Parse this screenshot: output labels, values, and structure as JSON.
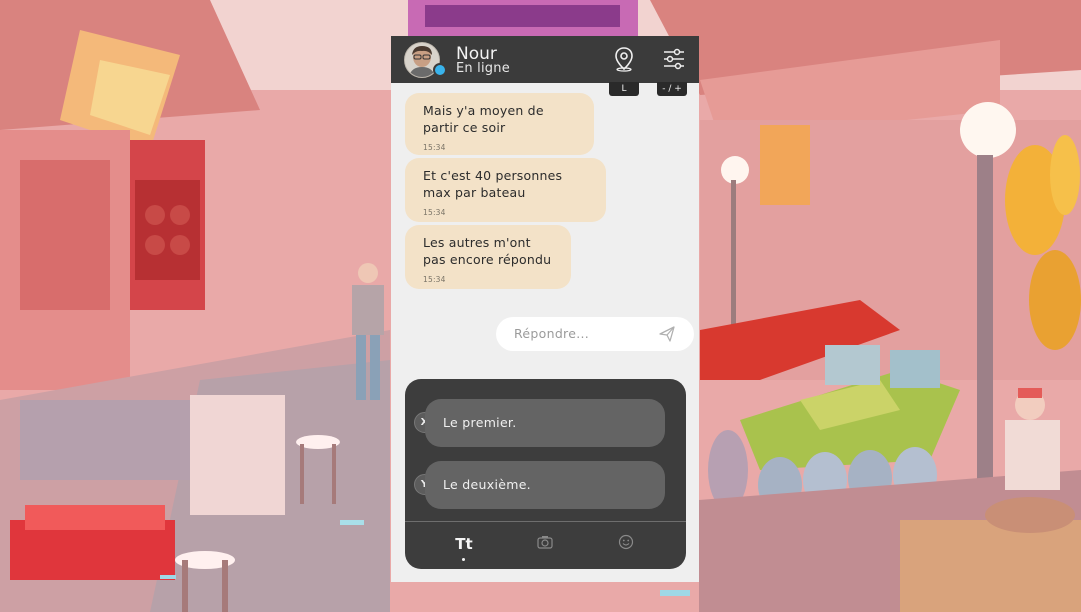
{
  "contact": {
    "name": "Nour",
    "status": "En ligne"
  },
  "header": {
    "location_hint": "L",
    "settings_hint": "- / +"
  },
  "messages": [
    {
      "text": "Mais y'a moyen de partir ce soir",
      "time": "15:34"
    },
    {
      "text": "Et c'est 40 personnes max par bateau",
      "time": "15:34"
    },
    {
      "text": "Les autres m'ont pas encore répondu",
      "time": "15:34"
    }
  ],
  "reply": {
    "placeholder": "Répondre..."
  },
  "choices": [
    {
      "button": "X",
      "label": "Le premier."
    },
    {
      "button": "Y",
      "label": "Le deuxième."
    }
  ],
  "tabs": {
    "text_tab": "Tt",
    "camera_icon": "camera-icon",
    "emoji_icon": "emoji-icon"
  },
  "colors": {
    "bubble": "#f3e2c8",
    "header": "#3b3b3b",
    "online": "#39b3ec",
    "choice_panel": "#3d3d3d"
  }
}
